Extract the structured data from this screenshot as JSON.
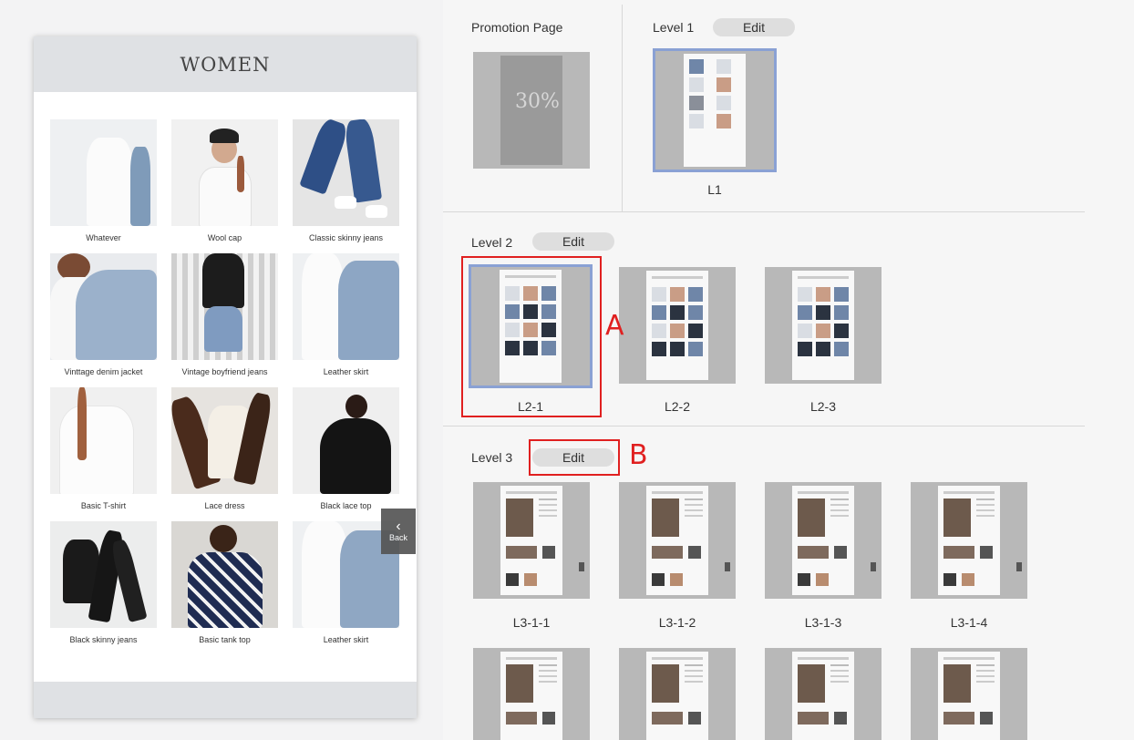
{
  "preview": {
    "title": "WOMEN",
    "back_label": "Back",
    "products": [
      {
        "name": "Whatever"
      },
      {
        "name": "Wool cap"
      },
      {
        "name": "Classic skinny jeans"
      },
      {
        "name": "Vinttage denim jacket"
      },
      {
        "name": "Vintage boyfriend jeans"
      },
      {
        "name": "Leather skirt"
      },
      {
        "name": "Basic T-shirt"
      },
      {
        "name": "Lace dress"
      },
      {
        "name": "Black lace top"
      },
      {
        "name": "Black skinny jeans"
      },
      {
        "name": "Basic tank top"
      },
      {
        "name": "Leather skirt"
      }
    ]
  },
  "panel": {
    "promotion": {
      "label": "Promotion Page",
      "discount_text": "30%"
    },
    "level1": {
      "label": "Level 1",
      "edit_label": "Edit",
      "thumbs": [
        "L1"
      ]
    },
    "level2": {
      "label": "Level 2",
      "edit_label": "Edit",
      "thumbs": [
        "L2-1",
        "L2-2",
        "L2-3"
      ]
    },
    "level3": {
      "label": "Level 3",
      "edit_label": "Edit",
      "thumbs": [
        "L3-1-1",
        "L3-1-2",
        "L3-1-3",
        "L3-1-4"
      ]
    }
  },
  "annotations": {
    "a": "A",
    "b": "B"
  },
  "colors": {
    "selection": "#8aa1d4",
    "annotation": "#e02020",
    "header": "#dfe1e4"
  }
}
